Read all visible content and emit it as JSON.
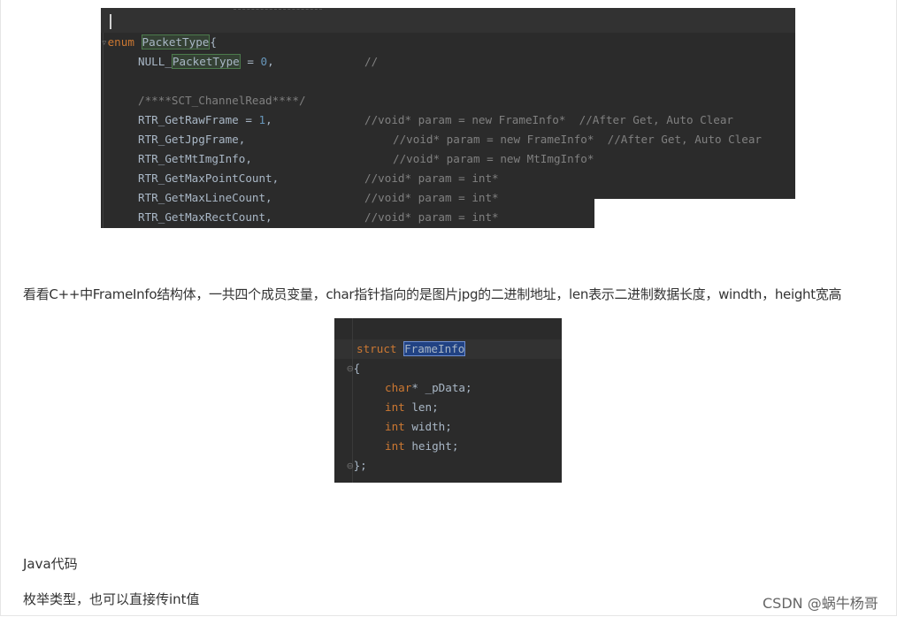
{
  "code1": {
    "line_enum_kw": "enum",
    "line_enum_name": "PacketType",
    "line_enum_brace": "{",
    "l_null_a": "NULL_",
    "l_null_b": "PacketType",
    "l_null_c": " = ",
    "l_null_num": "0",
    "l_null_d": ",",
    "l_null_cm": "//",
    "l_section": "/****SCT_ChannelRead****/",
    "l_raw_a": "RTR_GetRawFrame = ",
    "l_raw_num": "1",
    "l_raw_b": ",",
    "l_raw_cm": "//void* param = new FrameInfo*  //After Get, Auto Clear",
    "l_jpg": "RTR_GetJpgFrame,",
    "l_jpg_cm": "//void* param = new FrameInfo*  //After Get, Auto Clear",
    "l_mt": "RTR_GetMtImgInfo,",
    "l_mt_cm": "//void* param = new MtImgInfo*",
    "l_pt": "RTR_GetMaxPointCount,",
    "l_pt_cm": "//void* param = int*",
    "l_line": "RTR_GetMaxLineCount,",
    "l_line_cm": "//void* param = int*",
    "l_rect": "RTR_GetMaxRectCount,",
    "l_rect_cm": "//void* param = int*"
  },
  "paragraph": "看看C++中FrameInfo结构体，一共四个成员变量，char指针指向的是图片jpg的二进制地址，len表示二进制数据长度，windth，height宽高",
  "code2": {
    "struct_kw": "struct",
    "struct_name": "FrameInfo",
    "open_brace": "{",
    "f1_type": "char",
    "f1_rest": "* _pData;",
    "f2_type": "int",
    "f2_rest": " len;",
    "f3_type": "int",
    "f3_rest": " width;",
    "f4_type": "int",
    "f4_rest": " height;",
    "close_brace": "};"
  },
  "java_label": "Java代码",
  "enum_label": "枚举类型，也可以直接传int值",
  "watermark": "CSDN @蜗牛杨哥",
  "colors": {
    "editor_bg": "#2b2b2b",
    "keyword": "#cc7832",
    "comment": "#808080",
    "number": "#6897bb",
    "text": "#a9b7c6"
  }
}
